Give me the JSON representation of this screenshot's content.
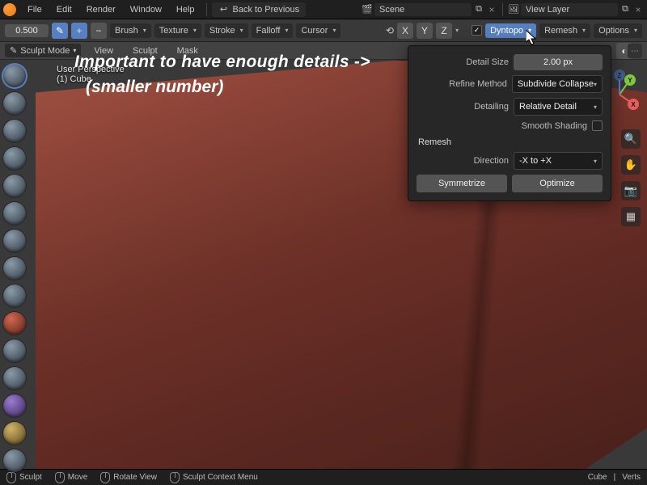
{
  "menubar": {
    "items": [
      "File",
      "Edit",
      "Render",
      "Window",
      "Help"
    ],
    "back_btn": "Back to Previous",
    "scene_label": "Scene",
    "viewlayer_label": "View Layer"
  },
  "toolbar": {
    "radius": "0.500",
    "brush": "Brush",
    "texture": "Texture",
    "stroke": "Stroke",
    "falloff": "Falloff",
    "cursor": "Cursor",
    "axes": [
      "X",
      "Y",
      "Z"
    ],
    "dyntopo": "Dyntopo",
    "remesh": "Remesh",
    "options": "Options"
  },
  "header2": {
    "mode": "Sculpt Mode",
    "menus": [
      "View",
      "Sculpt",
      "Mask"
    ]
  },
  "overlay": {
    "perspective": "User Perspective",
    "obj": "(1) Cube"
  },
  "annotation": {
    "line1": "Important to have enough details ->",
    "line2": "(smaller number)"
  },
  "panel": {
    "detail_size_label": "Detail Size",
    "detail_size_value": "2.00 px",
    "refine_label": "Refine Method",
    "refine_value": "Subdivide Collapse",
    "detailing_label": "Detailing",
    "detailing_value": "Relative Detail",
    "smooth_label": "Smooth Shading",
    "remesh_section": "Remesh",
    "direction_label": "Direction",
    "direction_value": "-X to +X",
    "symmetrize_btn": "Symmetrize",
    "optimize_btn": "Optimize"
  },
  "status": {
    "sculpt": "Sculpt",
    "move": "Move",
    "rotate": "Rotate View",
    "context": "Sculpt Context Menu",
    "cube": "Cube",
    "verts": "Verts"
  },
  "gizmo": {
    "x": "X",
    "y": "Y",
    "z": "Z"
  },
  "colors": {
    "accent": "#5680c2",
    "x": "#e85d5d",
    "y": "#7ec93f",
    "z": "#4f7fd6"
  }
}
